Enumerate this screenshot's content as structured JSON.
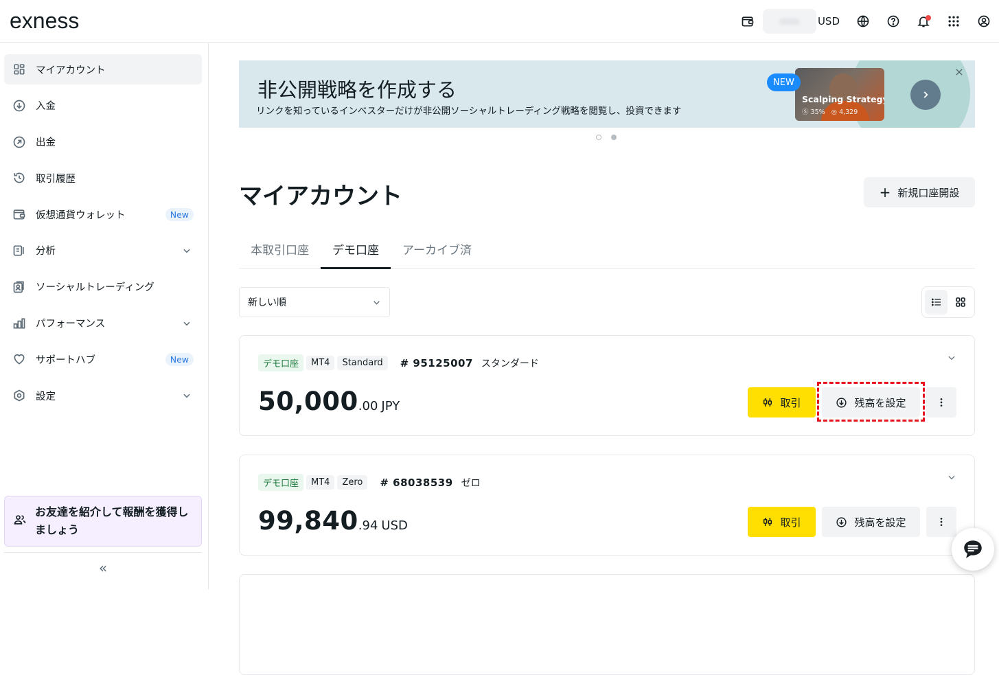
{
  "header": {
    "logo": "exness",
    "currency": "USD",
    "icons": [
      "wallet-icon",
      "globe-icon",
      "help-icon",
      "bell-icon",
      "apps-grid-icon",
      "profile-icon"
    ]
  },
  "sidebar": {
    "items": [
      {
        "label": "マイアカウント",
        "icon": "dashboard-icon",
        "active": true
      },
      {
        "label": "入金",
        "icon": "deposit-icon"
      },
      {
        "label": "出金",
        "icon": "withdraw-icon"
      },
      {
        "label": "取引履歴",
        "icon": "history-icon"
      },
      {
        "label": "仮想通貨ウォレット",
        "icon": "crypto-wallet-icon",
        "badge": "New"
      },
      {
        "label": "分析",
        "icon": "analytics-icon",
        "expandable": true
      },
      {
        "label": "ソーシャルトレーディング",
        "icon": "social-trading-icon"
      },
      {
        "label": "パフォーマンス",
        "icon": "performance-icon",
        "expandable": true
      },
      {
        "label": "サポートハブ",
        "icon": "heart-icon",
        "badge": "New"
      },
      {
        "label": "設定",
        "icon": "settings-icon",
        "expandable": true
      }
    ],
    "referral": "お友達を紹介して報酬を獲得しましょう",
    "collapse_glyph": "«"
  },
  "banner": {
    "title": "非公開戦略を作成する",
    "subtitle": "リンクを知っているインベスターだけが非公開ソーシャルトレーディング戦略を閲覧し、投資できます",
    "new_label": "NEW",
    "card_title": "Scalping Strategy",
    "card_return": "35%",
    "card_investors": "4,329",
    "slides": 2,
    "active_slide": 2
  },
  "page": {
    "title": "マイアカウント",
    "new_account_label": "新規口座開設",
    "tabs": [
      {
        "label": "本取引口座",
        "active": false
      },
      {
        "label": "デモ口座",
        "active": true
      },
      {
        "label": "アーカイブ済",
        "active": false
      }
    ],
    "sort_value": "新しい順",
    "view_mode": "list"
  },
  "accounts": [
    {
      "tags": [
        "デモ口座",
        "MT4",
        "Standard"
      ],
      "number": "# 95125007",
      "type": "スタンダード",
      "balance_int": "50,000",
      "balance_dec": ".00",
      "currency": "JPY",
      "trade_label": "取引",
      "set_balance_label": "残高を設定",
      "highlighted": true
    },
    {
      "tags": [
        "デモ口座",
        "MT4",
        "Zero"
      ],
      "number": "# 68038539",
      "type": "ゼロ",
      "balance_int": "99,840",
      "balance_dec": ".94",
      "currency": "USD",
      "trade_label": "取引",
      "set_balance_label": "残高を設定",
      "highlighted": false
    }
  ],
  "colors": {
    "accent_yellow": "#ffde02",
    "highlight_red": "#e8141c",
    "banner_bg": "#d8e8ec",
    "new_badge": "#1a8cff"
  }
}
